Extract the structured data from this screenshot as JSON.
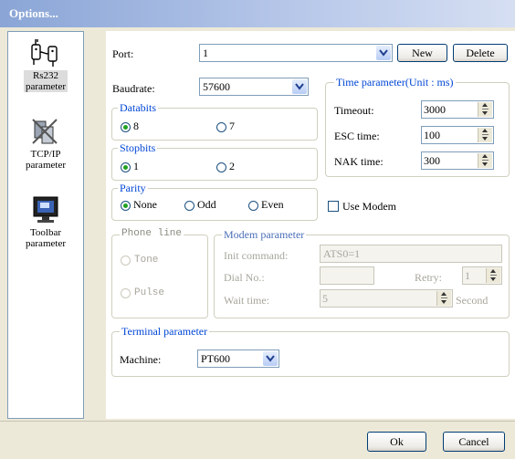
{
  "window": {
    "title": "Options..."
  },
  "sidebar": {
    "items": [
      {
        "label": "Rs232 parameter",
        "line1": "Rs232",
        "line2": "parameter",
        "icon": "serial-port-icon"
      },
      {
        "label": "TCP/IP parameter",
        "line1": "TCP/IP",
        "line2": "parameter",
        "icon": "network-icon"
      },
      {
        "label": "Toolbar parameter",
        "line1": "Toolbar",
        "line2": "parameter",
        "icon": "monitor-icon"
      }
    ]
  },
  "port": {
    "label": "Port:",
    "value": "1",
    "new_label": "New",
    "delete_label": "Delete"
  },
  "baudrate": {
    "label": "Baudrate:",
    "value": "57600"
  },
  "databits": {
    "legend": "Databits",
    "opt1": "8",
    "opt2": "7",
    "selected": "8"
  },
  "stopbits": {
    "legend": "Stopbits",
    "opt1": "1",
    "opt2": "2",
    "selected": "1"
  },
  "parity": {
    "legend": "Parity",
    "opt1": "None",
    "opt2": "Odd",
    "opt3": "Even",
    "selected": "None"
  },
  "time": {
    "legend": "Time parameter(Unit : ms)",
    "timeout_label": "Timeout:",
    "timeout": "3000",
    "esc_label": "ESC time:",
    "esc": "100",
    "nak_label": "NAK time:",
    "nak": "300"
  },
  "modem": {
    "use_label": "Use Modem",
    "phone_legend": "Phone line",
    "tone": "Tone",
    "pulse": "Pulse",
    "param_legend": "Modem parameter",
    "init_label": "Init command:",
    "init_value": "ATS0=1",
    "dial_label": "Dial No.:",
    "dial_value": "",
    "retry_label": "Retry:",
    "retry_value": "1",
    "wait_label": "Wait time:",
    "wait_value": "5",
    "second_label": "Second"
  },
  "terminal": {
    "legend": "Terminal parameter",
    "machine_label": "Machine:",
    "machine_value": "PT600"
  },
  "footer": {
    "ok_label": "Ok",
    "cancel_label": "Cancel"
  }
}
